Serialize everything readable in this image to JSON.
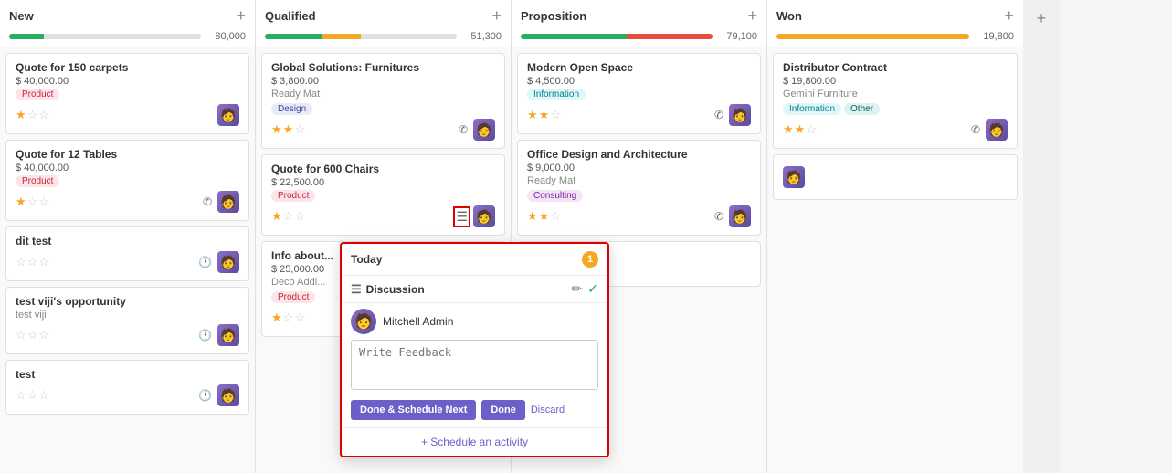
{
  "columns": [
    {
      "id": "new",
      "title": "New",
      "amount": "80,000",
      "progress": [
        {
          "color": "#27ae60",
          "pct": 18
        },
        {
          "color": "#e0e0e0",
          "pct": 82
        }
      ],
      "cards": [
        {
          "id": "c1",
          "title": "Quote for 150 carpets",
          "amount": "$ 40,000.00",
          "tags": [
            {
              "label": "Product",
              "type": "product"
            }
          ],
          "stars": [
            true,
            false,
            false
          ],
          "icons": [],
          "has_clock": false,
          "avatar": "👤"
        },
        {
          "id": "c2",
          "title": "Quote for 12 Tables",
          "amount": "$ 40,000.00",
          "tags": [
            {
              "label": "Product",
              "type": "product"
            }
          ],
          "stars": [
            true,
            false,
            false
          ],
          "icons": [
            "phone"
          ],
          "has_clock": false,
          "avatar": "👤"
        },
        {
          "id": "c3",
          "title": "dit test",
          "amount": "",
          "tags": [],
          "stars": [
            false,
            false,
            false
          ],
          "icons": [],
          "has_clock": true,
          "avatar": "👤"
        },
        {
          "id": "c4",
          "title": "test viji's opportunity",
          "amount": "",
          "subtitle": "test viji",
          "tags": [],
          "stars": [
            false,
            false,
            false
          ],
          "icons": [],
          "has_clock": true,
          "avatar": "👤"
        },
        {
          "id": "c5",
          "title": "test",
          "amount": "",
          "tags": [],
          "stars": [
            false,
            false,
            false
          ],
          "icons": [],
          "has_clock": true,
          "avatar": "👤"
        }
      ]
    },
    {
      "id": "qualified",
      "title": "Qualified",
      "amount": "51,300",
      "progress": [
        {
          "color": "#27ae60",
          "pct": 30
        },
        {
          "color": "#f5a623",
          "pct": 20
        },
        {
          "color": "#e0e0e0",
          "pct": 50
        }
      ],
      "cards": [
        {
          "id": "q1",
          "title": "Global Solutions: Furnitures",
          "amount": "$ 3,800.00",
          "subtitle": "Ready Mat",
          "tags": [
            {
              "label": "Design",
              "type": "design"
            }
          ],
          "stars": [
            true,
            true,
            false
          ],
          "icons": [
            "phone"
          ],
          "has_clock": false,
          "avatar": "👤"
        },
        {
          "id": "q2",
          "title": "Quote for 600 Chairs",
          "amount": "$ 22,500.00",
          "tags": [
            {
              "label": "Product",
              "type": "product"
            }
          ],
          "stars": [
            true,
            false,
            false
          ],
          "has_activity": true,
          "icons": [],
          "has_clock": false,
          "avatar": "👤"
        },
        {
          "id": "q3",
          "title": "Info about...",
          "amount": "$ 25,000.00",
          "subtitle": "Deco Addi...",
          "tags": [
            {
              "label": "Product",
              "type": "product"
            }
          ],
          "stars": [
            true,
            false,
            false
          ],
          "icons": [],
          "has_clock": false,
          "avatar": "👤"
        }
      ]
    },
    {
      "id": "proposition",
      "title": "Proposition",
      "amount": "79,100",
      "progress": [
        {
          "color": "#27ae60",
          "pct": 55
        },
        {
          "color": "#e74c3c",
          "pct": 45
        }
      ],
      "cards": [
        {
          "id": "p1",
          "title": "Modern Open Space",
          "amount": "$ 4,500.00",
          "tags": [
            {
              "label": "Information",
              "type": "information"
            }
          ],
          "stars": [
            true,
            true,
            false
          ],
          "icons": [
            "phone"
          ],
          "has_clock": false,
          "avatar": "👤"
        },
        {
          "id": "p2",
          "title": "Office Design and Architecture",
          "amount": "$ 9,000.00",
          "subtitle": "Ready Mat",
          "tags": [
            {
              "label": "Consulting",
              "type": "consulting"
            }
          ],
          "stars": [
            true,
            true,
            false
          ],
          "icons": [
            "phone"
          ],
          "has_clock": false,
          "avatar": "👤"
        },
        {
          "id": "p3",
          "title": "...",
          "amount": "",
          "tags": [],
          "stars": [],
          "icons": [],
          "has_clock": false,
          "avatar": "👤"
        }
      ]
    },
    {
      "id": "won",
      "title": "Won",
      "amount": "19,800",
      "progress": [
        {
          "color": "#f5a623",
          "pct": 100
        }
      ],
      "cards": [
        {
          "id": "w1",
          "title": "Distributor Contract",
          "amount": "$ 19,800.00",
          "subtitle": "Gemini Furniture",
          "tags": [
            {
              "label": "Information",
              "type": "information"
            },
            {
              "label": "Other",
              "type": "other"
            }
          ],
          "stars": [
            true,
            true,
            false
          ],
          "icons": [
            "phone"
          ],
          "has_clock": false,
          "avatar": "👤"
        },
        {
          "id": "w2",
          "title": "...",
          "amount": "",
          "tags": [],
          "stars": [],
          "icons": [],
          "has_clock": false,
          "avatar": "👤"
        }
      ]
    }
  ],
  "popup": {
    "header_label": "Today",
    "badge": "1",
    "activity_title": "Discussion",
    "user_name": "Mitchell Admin",
    "feedback_placeholder": "Write Feedback",
    "btn_done_schedule": "Done & Schedule Next",
    "btn_done": "Done",
    "btn_discard": "Discard",
    "schedule_link": "+ Schedule an activity"
  },
  "icons": {
    "star_filled": "★",
    "star_empty": "☆",
    "phone": "✆",
    "clock": "🕐",
    "add": "+",
    "edit": "✏",
    "check": "✓",
    "activity": "☰"
  }
}
